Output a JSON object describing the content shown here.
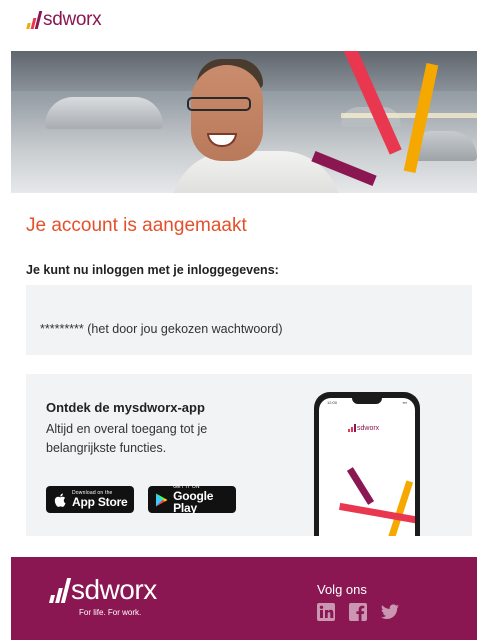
{
  "header": {
    "logo_text": "sdworx"
  },
  "hero": {
    "image": "smiling-man-office-photo"
  },
  "main": {
    "title": "Je account is aangemaakt",
    "subtitle": "Je kunt nu inloggen met je inloggegevens:",
    "password_line": "********* (het door jou gekozen wachtwoord)"
  },
  "app_promo": {
    "title": "Ontdek de mysdworx-app",
    "description": "Altijd en overal toegang tot je belangrijkste functies.",
    "app_store": {
      "small": "Download on the",
      "big": "App Store"
    },
    "google_play": {
      "small": "GET IT ON",
      "big": "Google Play"
    },
    "phone_logo": "sdworx"
  },
  "footer": {
    "logo_text": "sdworx",
    "tagline": "For life. For work.",
    "follow_label": "Volg ons",
    "social": [
      "linkedin-icon",
      "facebook-icon",
      "twitter-icon"
    ]
  },
  "colors": {
    "brand_purple": "#8b1752",
    "title_orange": "#e4502a",
    "accent_red": "#e8374f",
    "accent_yellow": "#f5a800",
    "panel_grey": "#f1f3f5"
  }
}
